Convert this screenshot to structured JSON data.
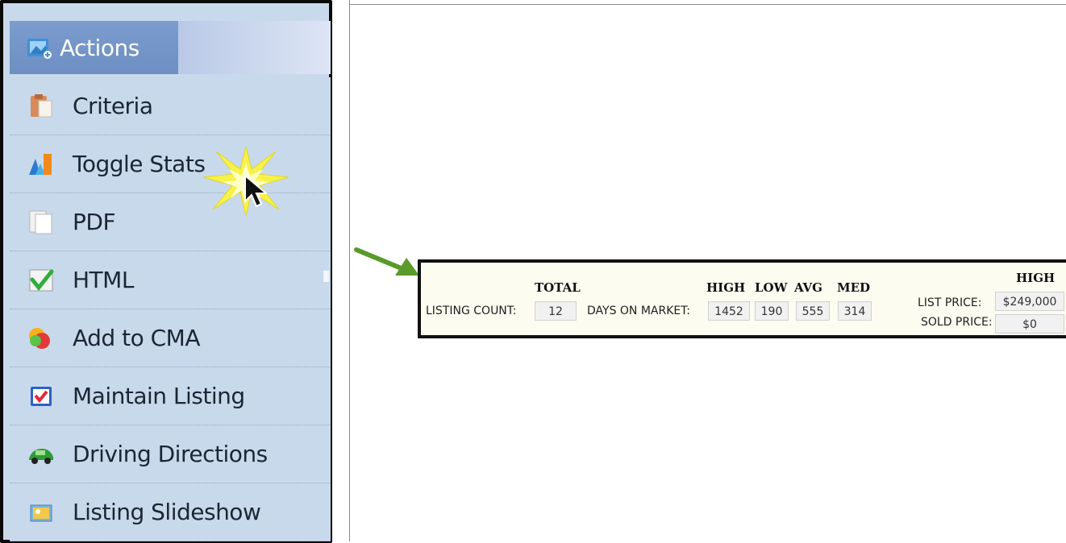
{
  "menu": {
    "header": {
      "label": "Actions",
      "icon": "actions-icon"
    },
    "items": [
      {
        "label": "Criteria",
        "icon": "clipboard-icon"
      },
      {
        "label": "Toggle Stats",
        "icon": "bar-chart-icon"
      },
      {
        "label": "PDF",
        "icon": "document-icon"
      },
      {
        "label": "HTML",
        "icon": "checkmark-icon"
      },
      {
        "label": "Add to CMA",
        "icon": "add-cma-icon"
      },
      {
        "label": "Maintain Listing",
        "icon": "checkbox-icon"
      },
      {
        "label": "Driving Directions",
        "icon": "car-icon"
      },
      {
        "label": "Listing Slideshow",
        "icon": "slideshow-icon"
      }
    ]
  },
  "stats": {
    "total_header": "TOTAL",
    "listing_count_label": "LISTING COUNT:",
    "listing_count": "12",
    "dom_headers": {
      "high": "HIGH",
      "low": "LOW",
      "avg": "AVG",
      "med": "MED"
    },
    "days_on_market_label": "DAYS ON MARKET:",
    "days_on_market": {
      "high": "1452",
      "low": "190",
      "avg": "555",
      "med": "314"
    },
    "price_high_header": "HIGH",
    "list_price_label": "LIST PRICE:",
    "list_price_high": "$249,000",
    "sold_price_label": "SOLD PRICE:",
    "sold_price_high": "$0"
  },
  "colors": {
    "menu_bg": "#c9d9ec",
    "header_bg": "#7b9ccd",
    "arrow": "#5a9a2a",
    "stats_bg": "#fdfcf1"
  }
}
